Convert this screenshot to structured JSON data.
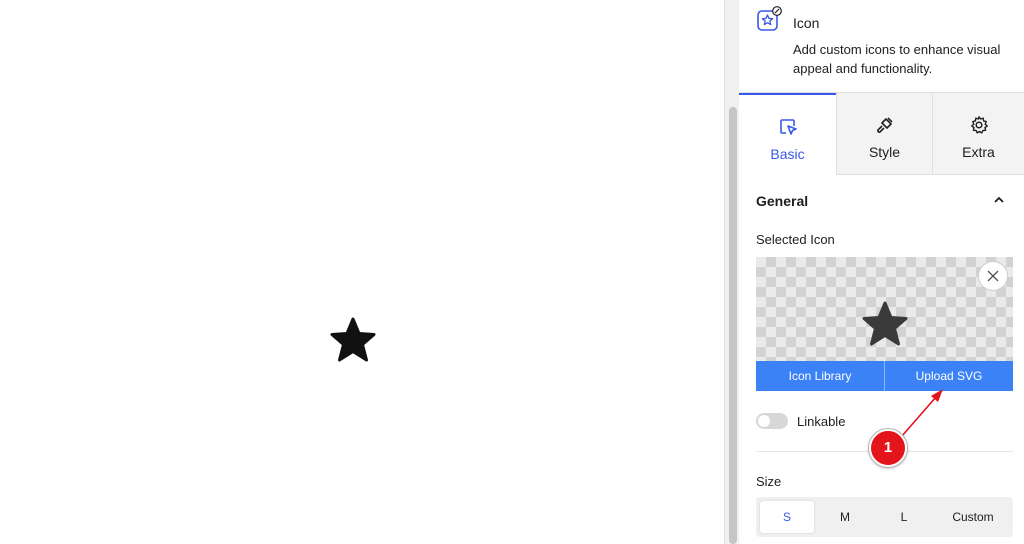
{
  "block": {
    "title": "Icon",
    "description": "Add custom icons to enhance visual appeal and functionality.",
    "icon": "star-badge-icon"
  },
  "tabs": [
    {
      "label": "Basic",
      "icon": "cursor-select-icon",
      "active": true
    },
    {
      "label": "Style",
      "icon": "paint-brush-icon",
      "active": false
    },
    {
      "label": "Extra",
      "icon": "gear-icon",
      "active": false
    }
  ],
  "general": {
    "title": "General",
    "selected_icon_label": "Selected Icon",
    "selected_icon": "star-icon",
    "icon_library_label": "Icon Library",
    "upload_svg_label": "Upload SVG",
    "linkable_label": "Linkable",
    "linkable_on": false
  },
  "size": {
    "label": "Size",
    "options": [
      "S",
      "M",
      "L",
      "Custom"
    ],
    "selected": "S"
  },
  "annotation": {
    "step_number": "1"
  },
  "colors": {
    "accent": "#3858e9",
    "button_blue": "#3b82f6",
    "annotation_red": "#e4141b"
  }
}
